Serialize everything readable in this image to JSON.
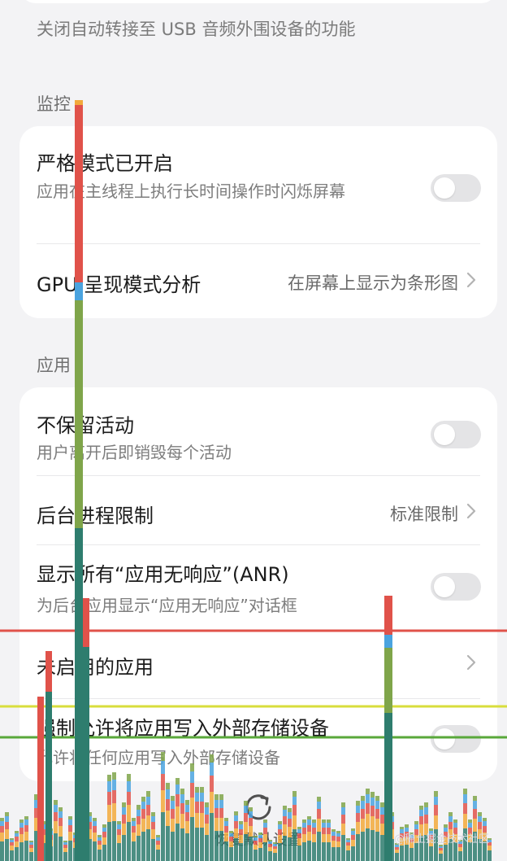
{
  "top": {
    "description": "关闭自动转接至 USB 音频外围设备的功能"
  },
  "sections": {
    "monitoring": {
      "label": "监控",
      "strict_mode": {
        "title": "严格模式已开启",
        "subtitle": "应用在主线程上执行长时间操作时闪烁屏幕",
        "enabled": false
      },
      "gpu_profiling": {
        "title": "GPU 呈现模式分析",
        "value": "在屏幕上显示为条形图"
      }
    },
    "apps": {
      "label": "应用",
      "dont_keep_activities": {
        "title": "不保留活动",
        "subtitle": "用户离开后即销毁每个活动",
        "enabled": false
      },
      "background_limit": {
        "title": "后台进程限制",
        "value": "标准限制"
      },
      "show_all_anr": {
        "title": "显示所有“应用无响应”(ANR)",
        "subtitle": "为后台应用显示“应用无响应”对话框",
        "enabled": false
      },
      "inactive_apps": {
        "title": "未启用的应用"
      },
      "force_external_storage": {
        "title": "强制允许将应用写入外部存储设备",
        "subtitle": "允许将任何应用写入外部存储设备",
        "enabled": false
      }
    }
  },
  "footer": {
    "reset_label": "恢复默认设置",
    "watermark": "@稀土掘金技术社区"
  },
  "colors": {
    "background": "#f3f3f5",
    "card": "#ffffff",
    "toggle_off": "#e4e4e6",
    "gpu_red": "#e0524a",
    "gpu_green": "#7fa54a",
    "gpu_teal": "#2e7d6e",
    "gpu_orange": "#f2a93b",
    "gpu_blue": "#4aa3df",
    "gpu_yellow_line": "#d8de3c",
    "gpu_green_line": "#59a83a"
  },
  "icons": {
    "chevron": "chevron-right-icon",
    "reset": "reset-icon"
  }
}
